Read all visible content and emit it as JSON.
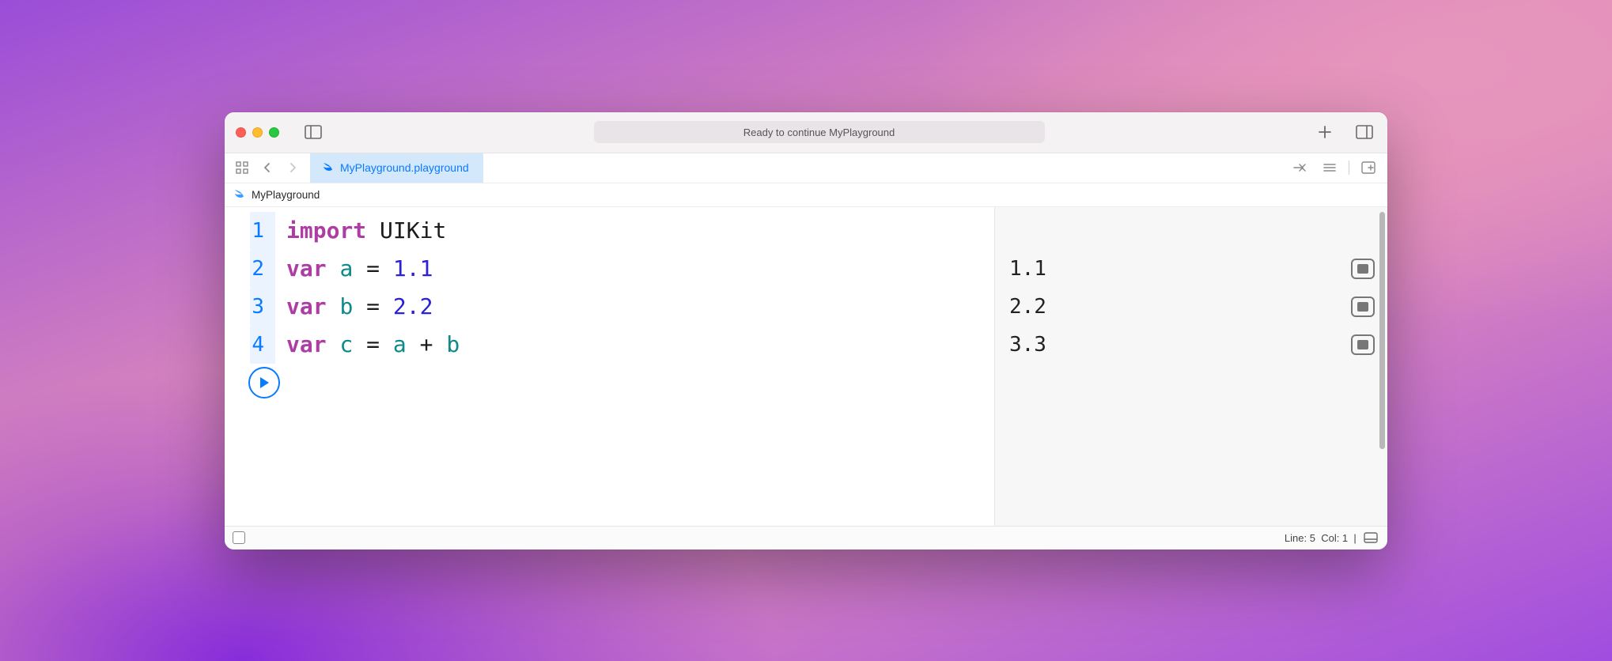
{
  "titlebar": {
    "status": "Ready to continue MyPlayground"
  },
  "tabs": {
    "active": {
      "label": "MyPlayground.playground"
    }
  },
  "breadcrumb": {
    "label": "MyPlayground"
  },
  "code": {
    "lines": [
      {
        "n": "1",
        "tokens": [
          {
            "t": "import",
            "c": "kw"
          },
          {
            "t": " ",
            "c": "plain"
          },
          {
            "t": "UIKit",
            "c": "type"
          }
        ]
      },
      {
        "n": "2",
        "tokens": [
          {
            "t": "var",
            "c": "kw"
          },
          {
            "t": " ",
            "c": "plain"
          },
          {
            "t": "a",
            "c": "id"
          },
          {
            "t": " ",
            "c": "plain"
          },
          {
            "t": "=",
            "c": "op"
          },
          {
            "t": " ",
            "c": "plain"
          },
          {
            "t": "1.1",
            "c": "num"
          }
        ]
      },
      {
        "n": "3",
        "tokens": [
          {
            "t": "var",
            "c": "kw"
          },
          {
            "t": " ",
            "c": "plain"
          },
          {
            "t": "b",
            "c": "id"
          },
          {
            "t": " ",
            "c": "plain"
          },
          {
            "t": "=",
            "c": "op"
          },
          {
            "t": " ",
            "c": "plain"
          },
          {
            "t": "2.2",
            "c": "num"
          }
        ]
      },
      {
        "n": "4",
        "tokens": [
          {
            "t": "var",
            "c": "kw"
          },
          {
            "t": " ",
            "c": "plain"
          },
          {
            "t": "c",
            "c": "id"
          },
          {
            "t": " ",
            "c": "plain"
          },
          {
            "t": "=",
            "c": "op"
          },
          {
            "t": " ",
            "c": "plain"
          },
          {
            "t": "a",
            "c": "id"
          },
          {
            "t": " ",
            "c": "plain"
          },
          {
            "t": "+",
            "c": "op"
          },
          {
            "t": " ",
            "c": "plain"
          },
          {
            "t": "b",
            "c": "id"
          }
        ]
      }
    ]
  },
  "results": [
    {
      "value": "1.1"
    },
    {
      "value": "2.2"
    },
    {
      "value": "3.3"
    }
  ],
  "statusbar": {
    "line": "Line: 5",
    "col": "Col: 1"
  }
}
